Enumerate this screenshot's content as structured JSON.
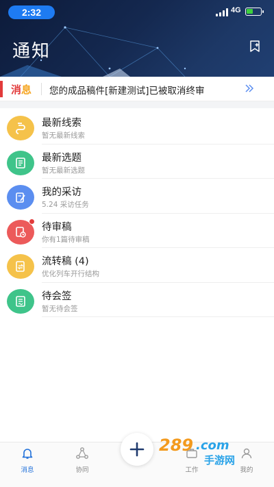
{
  "status_bar": {
    "time": "2:32",
    "network": "4G"
  },
  "header": {
    "title": "通知"
  },
  "notice": {
    "tag_part1": "消",
    "tag_part2": "息",
    "text": "您的成品稿件[新建测试]已被取消终审"
  },
  "items": [
    {
      "title": "最新线索",
      "subtitle": "暂无最新线索",
      "color": "#f5c24a",
      "icon": "link-icon"
    },
    {
      "title": "最新选题",
      "subtitle": "暂无最新选题",
      "color": "#3fc48a",
      "icon": "document-list-icon"
    },
    {
      "title": "我的采访",
      "subtitle": "5.24 采访任务",
      "color": "#5b8ef0",
      "icon": "interview-edit-icon"
    },
    {
      "title": "待审稿",
      "subtitle": "你有1篇待审稿",
      "color": "#ec5a5a",
      "icon": "review-clock-icon",
      "badge": true
    },
    {
      "title": "流转稿 (4)",
      "subtitle": "优化列车开行结构",
      "color": "#f5c24a",
      "icon": "transfer-document-icon"
    },
    {
      "title": "待会签",
      "subtitle": "暂无待会签",
      "color": "#3fc48a",
      "icon": "sign-document-icon"
    }
  ],
  "tabs": [
    {
      "label": "消息",
      "icon": "bell-icon",
      "active": true
    },
    {
      "label": "协同",
      "icon": "collaboration-icon",
      "active": false
    },
    {
      "label": "工作",
      "icon": "work-icon",
      "active": false
    },
    {
      "label": "我的",
      "icon": "profile-icon",
      "active": false
    }
  ],
  "fab": {
    "icon": "plus-icon"
  },
  "watermark": {
    "text": "289.com 手游网"
  },
  "colors": {
    "accent_blue": "#1e6fd9",
    "alert_red": "#e23b3b",
    "header_dark": "#14284f"
  }
}
